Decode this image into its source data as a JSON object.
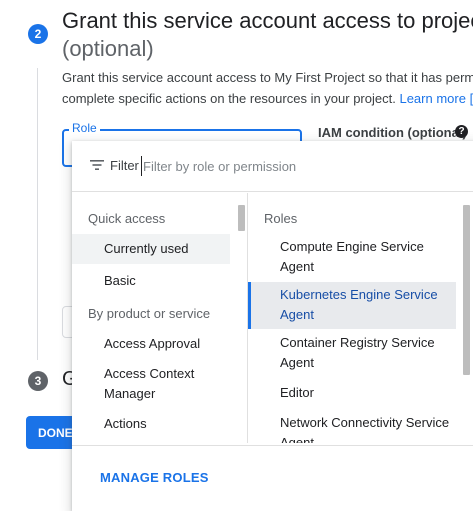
{
  "step2": {
    "number": "2",
    "title": "Grant this service account access to project",
    "title_optional": "(optional)",
    "description_line1": "Grant this service account access to My First Project so that it has perm",
    "description_line2": "complete specific actions on the resources in your project.",
    "learn_more": "Learn more",
    "role_label": "Role",
    "iam_condition_label": "IAM condition (optional)",
    "help_icon": "?"
  },
  "step3": {
    "number": "3",
    "title": "G"
  },
  "done_button": "DONE",
  "dropdown": {
    "filter_label": "Filter",
    "filter_placeholder": "Filter by role or permission",
    "left": {
      "quick_access_heading": "Quick access",
      "quick_access_items": [
        "Currently used",
        "Basic"
      ],
      "by_product_heading": "By product or service",
      "product_items": [
        "Access Approval",
        "Access Context\nManager",
        "Actions"
      ]
    },
    "right": {
      "heading": "Roles",
      "roles": [
        "Compute Engine Service Agent",
        "Kubernetes Engine Service Agent",
        "Container Registry Service Agent",
        "Editor",
        "Network Connectivity Service Agent"
      ]
    },
    "manage_roles": "MANAGE ROLES"
  },
  "colors": {
    "accent": "#1a73e8",
    "selected_text": "#174ea6"
  },
  "icons": {
    "filter": "filter-lines-icon",
    "help": "help-circle-icon",
    "external": "open-in-new-icon"
  }
}
